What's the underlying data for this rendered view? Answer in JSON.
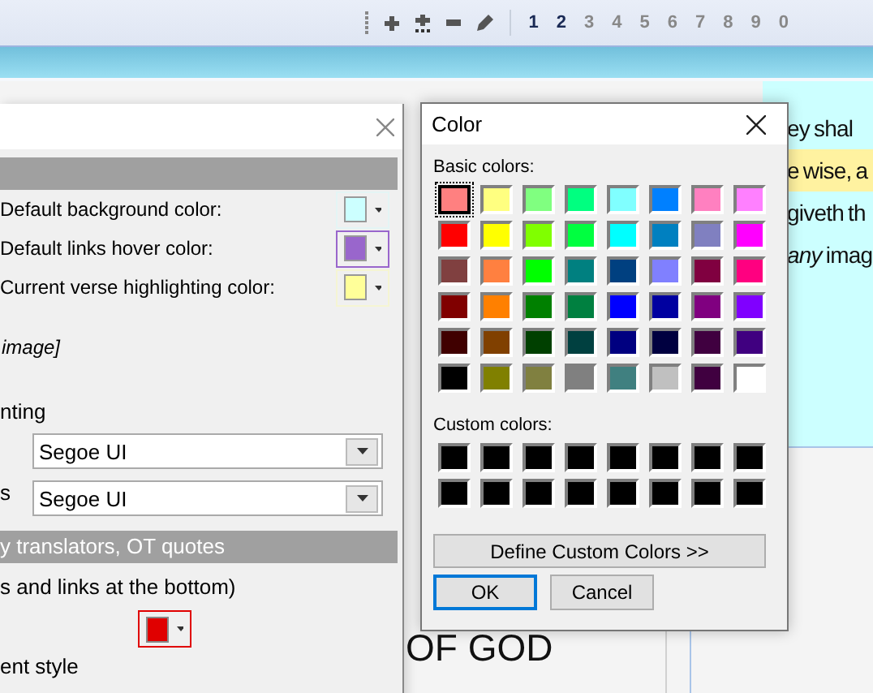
{
  "toolbar": {
    "numbers": [
      {
        "label": "1",
        "selected": true
      },
      {
        "label": "2",
        "selected": true
      },
      {
        "label": "3",
        "selected": false
      },
      {
        "label": "4",
        "selected": false
      },
      {
        "label": "5",
        "selected": false
      },
      {
        "label": "6",
        "selected": false
      },
      {
        "label": "7",
        "selected": false
      },
      {
        "label": "8",
        "selected": false
      },
      {
        "label": "9",
        "selected": false
      },
      {
        "label": "0",
        "selected": false
      }
    ]
  },
  "background_text": [
    {
      "kind": "plain",
      "text": "ey shal"
    },
    {
      "kind": "highlighted",
      "text": "e wise, a"
    },
    {
      "kind": "plain",
      "text": "giveth th"
    },
    {
      "kind": "plain",
      "text": "*any* imag"
    }
  ],
  "heading": "OF GOD",
  "options_dialog": {
    "color_rows": [
      {
        "label": "Default background color:",
        "color": "#ccffff",
        "focused": false
      },
      {
        "label": "Default links hover color:",
        "color": "#9966cc",
        "focused": true
      },
      {
        "label": "Current verse highlighting color:",
        "color": "#ffff99",
        "focused": false
      }
    ],
    "italic_note": "image]",
    "section_label": "nting",
    "fonts": [
      {
        "value": "Segoe UI"
      },
      {
        "label": "s",
        "value": "Segoe UI"
      }
    ],
    "section_bar": "y translators, OT quotes",
    "note": "s and links at the bottom)",
    "color_button": {
      "color": "#e00000",
      "focused": true
    },
    "trailing_text": "ent style"
  },
  "color_dialog": {
    "title": "Color",
    "basic_label": "Basic colors:",
    "basic_colors": [
      {
        "color": "#ff8080",
        "selected": true
      },
      {
        "color": "#ffff80",
        "selected": false
      },
      {
        "color": "#80ff80",
        "selected": false
      },
      {
        "color": "#00ff80",
        "selected": false
      },
      {
        "color": "#80ffff",
        "selected": false
      },
      {
        "color": "#0080ff",
        "selected": false
      },
      {
        "color": "#ff80c0",
        "selected": false
      },
      {
        "color": "#ff80ff",
        "selected": false
      },
      {
        "color": "#ff0000",
        "selected": false
      },
      {
        "color": "#ffff00",
        "selected": false
      },
      {
        "color": "#80ff00",
        "selected": false
      },
      {
        "color": "#00ff40",
        "selected": false
      },
      {
        "color": "#00ffff",
        "selected": false
      },
      {
        "color": "#0080c0",
        "selected": false
      },
      {
        "color": "#8080c0",
        "selected": false
      },
      {
        "color": "#ff00ff",
        "selected": false
      },
      {
        "color": "#804040",
        "selected": false
      },
      {
        "color": "#ff8040",
        "selected": false
      },
      {
        "color": "#00ff00",
        "selected": false
      },
      {
        "color": "#008080",
        "selected": false
      },
      {
        "color": "#004080",
        "selected": false
      },
      {
        "color": "#8080ff",
        "selected": false
      },
      {
        "color": "#800040",
        "selected": false
      },
      {
        "color": "#ff0080",
        "selected": false
      },
      {
        "color": "#800000",
        "selected": false
      },
      {
        "color": "#ff8000",
        "selected": false
      },
      {
        "color": "#008000",
        "selected": false
      },
      {
        "color": "#008040",
        "selected": false
      },
      {
        "color": "#0000ff",
        "selected": false
      },
      {
        "color": "#0000a0",
        "selected": false
      },
      {
        "color": "#800080",
        "selected": false
      },
      {
        "color": "#8000ff",
        "selected": false
      },
      {
        "color": "#400000",
        "selected": false
      },
      {
        "color": "#804000",
        "selected": false
      },
      {
        "color": "#004000",
        "selected": false
      },
      {
        "color": "#004040",
        "selected": false
      },
      {
        "color": "#000080",
        "selected": false
      },
      {
        "color": "#000040",
        "selected": false
      },
      {
        "color": "#400040",
        "selected": false
      },
      {
        "color": "#400080",
        "selected": false
      },
      {
        "color": "#000000",
        "selected": false
      },
      {
        "color": "#808000",
        "selected": false
      },
      {
        "color": "#808040",
        "selected": false
      },
      {
        "color": "#808080",
        "selected": false
      },
      {
        "color": "#408080",
        "selected": false
      },
      {
        "color": "#c0c0c0",
        "selected": false
      },
      {
        "color": "#400040",
        "selected": false
      },
      {
        "color": "#ffffff",
        "selected": false
      }
    ],
    "custom_label": "Custom colors:",
    "custom_colors": [
      {
        "color": "#000000"
      },
      {
        "color": "#000000"
      },
      {
        "color": "#000000"
      },
      {
        "color": "#000000"
      },
      {
        "color": "#000000"
      },
      {
        "color": "#000000"
      },
      {
        "color": "#000000"
      },
      {
        "color": "#000000"
      },
      {
        "color": "#000000"
      },
      {
        "color": "#000000"
      },
      {
        "color": "#000000"
      },
      {
        "color": "#000000"
      },
      {
        "color": "#000000"
      },
      {
        "color": "#000000"
      },
      {
        "color": "#000000"
      },
      {
        "color": "#000000"
      }
    ],
    "define_button": "Define Custom Colors >>",
    "buttons": [
      {
        "label": "OK",
        "default": true
      },
      {
        "label": "Cancel",
        "default": false
      }
    ]
  }
}
